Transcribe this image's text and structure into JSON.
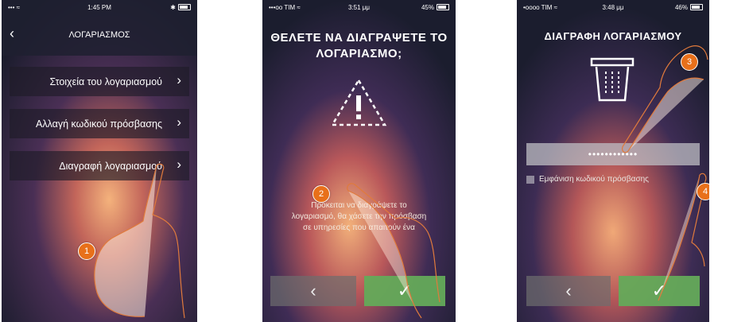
{
  "screen1": {
    "status": {
      "carrier": "••• ≈",
      "time": "1:45 PM",
      "icons": "✱"
    },
    "title": "ΛΟΓΑΡΙΑΣΜΟΣ",
    "back_icon": "‹",
    "menu_items": [
      {
        "label": "Στοιχεία του λογαριασμού"
      },
      {
        "label": "Αλλαγή κωδικού πρόσβασης"
      },
      {
        "label": "Διαγραφή λογαριασμού"
      }
    ],
    "chevron": "›",
    "badge": "1"
  },
  "screen2": {
    "status": {
      "carrier": "•••oo TIM ≈",
      "time": "3:51 μμ",
      "battery": "45%"
    },
    "title_line1": "ΘΕΛΕΤΕ ΝΑ ΔΙΑΓΡΑΨΕΤΕ ΤΟ",
    "title_line2": "ΛΟΓΑΡΙΑΣΜΟ;",
    "body_line1": "Πρόκειται να διαγράψετε το",
    "body_line2": "λογαριασμό, θα χάσετε την πρόσβαση",
    "body_line3": "σε υπηρεσίες που απαιτούν ένα",
    "back_label": "‹",
    "ok_label": "✓",
    "badge": "2"
  },
  "screen3": {
    "status": {
      "carrier": "•oooo TIM ≈",
      "time": "3:48 μμ",
      "battery": "46%"
    },
    "title": "ΔΙΑΓΡΑΦΗ ΛΟΓΑΡΙΑΣΜΟΥ",
    "password_value": "••••••••••••",
    "show_password_label": "Εμφάνιση κωδικού πρόσβασης",
    "back_label": "‹",
    "ok_label": "✓",
    "badge_3": "3",
    "badge_4": "4"
  }
}
